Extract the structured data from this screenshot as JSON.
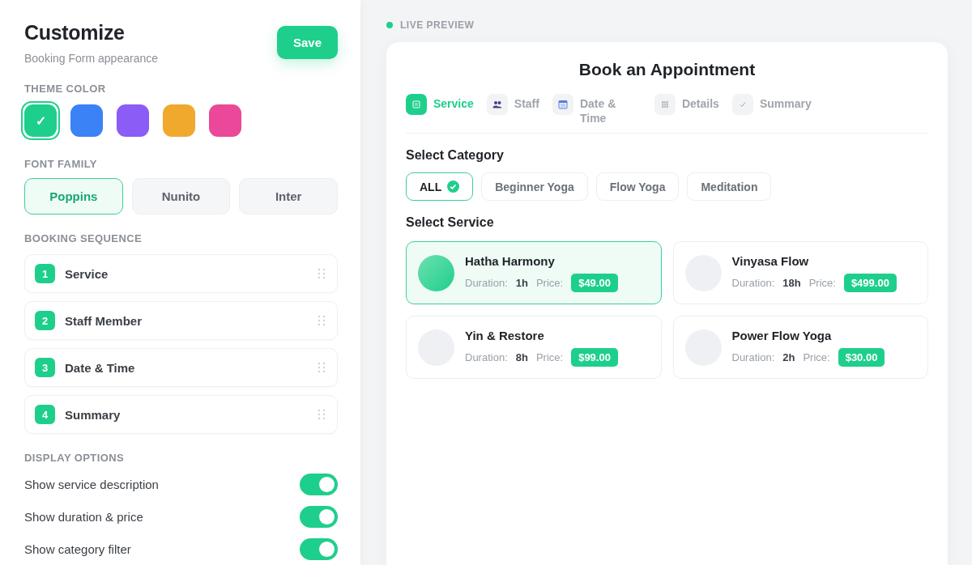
{
  "editor": {
    "title": "Customize",
    "subtitle": "Booking Form appearance",
    "save_button": "Save",
    "theme_color": {
      "heading": "THEME COLOR",
      "swatches": [
        {
          "color": "#1ecf8c",
          "selected": true,
          "mark": "✓"
        },
        {
          "color": "#3b82f6",
          "selected": false
        },
        {
          "color": "#8b5cf6",
          "selected": false
        },
        {
          "color": "#f0a92c",
          "selected": false
        },
        {
          "color": "#ec4899",
          "selected": false
        }
      ]
    },
    "font_family": {
      "heading": "FONT FAMILY",
      "options": [
        {
          "label": "Poppins",
          "selected": true
        },
        {
          "label": "Nunito",
          "selected": false
        },
        {
          "label": "Inter",
          "selected": false
        }
      ]
    },
    "booking_sequence": {
      "heading": "BOOKING SEQUENCE",
      "steps": [
        {
          "number": "1",
          "label": "Service"
        },
        {
          "number": "2",
          "label": "Staff Member"
        },
        {
          "number": "3",
          "label": "Date & Time"
        },
        {
          "number": "4",
          "label": "Summary"
        }
      ]
    },
    "display_options": {
      "heading": "DISPLAY OPTIONS",
      "options": [
        {
          "label": "Show service description",
          "on": true
        },
        {
          "label": "Show duration & price",
          "on": true
        },
        {
          "label": "Show category filter",
          "on": true
        }
      ]
    }
  },
  "preview": {
    "label": "LIVE PREVIEW",
    "title": "Book an Appointment",
    "steps": [
      {
        "kind": "list",
        "label": "Service",
        "selected": true
      },
      {
        "kind": "people",
        "label": "Staff",
        "selected": false
      },
      {
        "kind": "calendar",
        "label": "Date & Time",
        "selected": false
      },
      {
        "kind": "grid",
        "label": "Details",
        "selected": false
      },
      {
        "kind": "check",
        "label": "Summary",
        "selected": false
      }
    ],
    "category_heading": "Select Category",
    "categories": [
      {
        "label": "ALL",
        "selected": true
      },
      {
        "label": "Beginner Yoga",
        "selected": false
      },
      {
        "label": "Flow Yoga",
        "selected": false
      },
      {
        "label": "Meditation",
        "selected": false
      }
    ],
    "service_heading": "Select Service",
    "services": [
      {
        "name": "Hatha Harmony",
        "duration_label": "Duration:",
        "duration": "1h",
        "price_label": "Price:",
        "price": "$49.00",
        "selected": true
      },
      {
        "name": "Vinyasa Flow",
        "duration_label": "Duration:",
        "duration": "18h",
        "price_label": "Price:",
        "price": "$499.00",
        "selected": false
      },
      {
        "name": "Yin & Restore",
        "duration_label": "Duration:",
        "duration": "8h",
        "price_label": "Price:",
        "price": "$99.00",
        "selected": false
      },
      {
        "name": "Power Flow Yoga",
        "duration_label": "Duration:",
        "duration": "2h",
        "price_label": "Price:",
        "price": "$30.00",
        "selected": false
      }
    ]
  }
}
